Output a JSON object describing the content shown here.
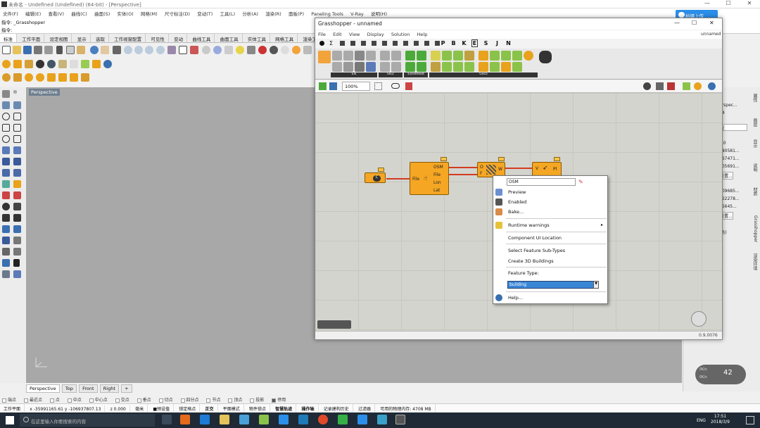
{
  "window": {
    "title": "未命名 - Undefined (Undefined) (64-bit) - [Perspective]",
    "minimize": "—",
    "maximize": "☐",
    "close": "✕"
  },
  "menu": [
    "文件(F)",
    "编辑(E)",
    "查看(V)",
    "曲线(C)",
    "曲面(S)",
    "实体(O)",
    "网格(M)",
    "尺寸标注(D)",
    "变动(T)",
    "工具(L)",
    "分析(A)",
    "渲染(R)",
    "面板(P)",
    "Paneling Tools",
    "V-Ray",
    "说明(H)"
  ],
  "command": {
    "line1": "指令: _Grasshopper",
    "line2": "指令:"
  },
  "upload_button": "拍摄上传",
  "toolbar_tabs": [
    {
      "label": "标准",
      "active": true
    },
    {
      "label": "工作平面"
    },
    {
      "label": "设定视图"
    },
    {
      "label": "显示"
    },
    {
      "label": "选取"
    },
    {
      "label": "工作视窗配置"
    },
    {
      "label": "可见性"
    },
    {
      "label": "变动"
    },
    {
      "label": "曲线工具"
    },
    {
      "label": "曲面工具"
    },
    {
      "label": "实体工具"
    },
    {
      "label": "网格工具"
    },
    {
      "label": "渲染工具"
    }
  ],
  "viewport": {
    "label": "Perspective",
    "tabs": [
      "Perspective",
      "Top",
      "Front",
      "Right",
      "+"
    ]
  },
  "osnaps": [
    "端点",
    "最近点",
    "点",
    "中点",
    "中心点",
    "交点",
    "垂点",
    "切点",
    "四分点",
    "节点",
    "顶点",
    "投影",
    "停用"
  ],
  "statusbar": [
    {
      "label": "工作平面"
    },
    {
      "label": "x -35991165.61 y -106937807.13"
    },
    {
      "label": "z 0.000"
    },
    {
      "label": "毫米"
    },
    {
      "label": "■预设值"
    },
    {
      "label": "锁定格点"
    },
    {
      "label": "正交",
      "bold": true
    },
    {
      "label": "平面模式"
    },
    {
      "label": "物件锁点"
    },
    {
      "label": "智慧轨迹",
      "bold": true
    },
    {
      "label": "操作轴",
      "bold": true
    },
    {
      "label": "记录建构历史"
    },
    {
      "label": "过滤器"
    },
    {
      "label": "可用的物理内存: 4708 MB"
    }
  ],
  "taskbar": {
    "search_placeholder": "在这里输入你要搜索的内容",
    "lang": "ENG",
    "time": "17:51",
    "date": "2018/3/9"
  },
  "right_panel": {
    "values": [
      "erspec...",
      "54",
      "视",
      "5.0",
      "180581...",
      "367471...",
      "105691...",
      "设置...",
      "109685...",
      "322278...",
      "35645...",
      "设置...",
      "(色)"
    ],
    "vtabs": [
      "属性",
      "图层",
      "显示",
      "说明",
      "材质",
      "Grasshopper",
      "渲染环境"
    ]
  },
  "gauge": {
    "percent": "42",
    "up": "0K/s",
    "down": "0K/s"
  },
  "grasshopper": {
    "title": "Grasshopper - unnamed",
    "document_name": "unnamed",
    "menu": [
      "File",
      "Edit",
      "View",
      "Display",
      "Solution",
      "Help"
    ],
    "categories": [
      "P",
      "B",
      "K",
      "E",
      "S",
      "J",
      "N"
    ],
    "active_category": "E",
    "panel_groups": [
      "Elk",
      "Elk2",
      "ExcelRead",
      "Geco"
    ],
    "zoom": "100%",
    "status_value": "0.9.0076",
    "nodes": {
      "osm": {
        "input": "File",
        "outputs": [
          "OSM",
          "File",
          "Lon",
          "Lat"
        ]
      },
      "location": {
        "inputs": [
          "O",
          "F"
        ],
        "output": "W"
      },
      "topo": {
        "input": "V",
        "output": "Pl"
      },
      "path": {
        "label": "C"
      }
    },
    "context_menu": {
      "name_value": "OSM",
      "items": [
        {
          "label": "Preview",
          "icon": "preview-icon"
        },
        {
          "label": "Enabled",
          "icon": "enabled-icon"
        },
        {
          "label": "Bake...",
          "icon": "bake-icon"
        },
        {
          "label": "Runtime warnings",
          "icon": "warning-icon"
        },
        {
          "label": "Component UI Location"
        },
        {
          "label": "Select Feature Sub-Types"
        },
        {
          "label": "Create 3D Buildings"
        },
        {
          "label": "Feature Type:"
        },
        {
          "label": "Help...",
          "icon": "help-icon"
        }
      ],
      "feature_type_value": "building"
    }
  },
  "colors": {
    "accent": "#2b8ee8",
    "node": "#f5a623",
    "wire": "#d43b22",
    "taskbar": "#1f2a36",
    "viewport": "#a8a8a8",
    "canvas": "#d4d4ce"
  }
}
